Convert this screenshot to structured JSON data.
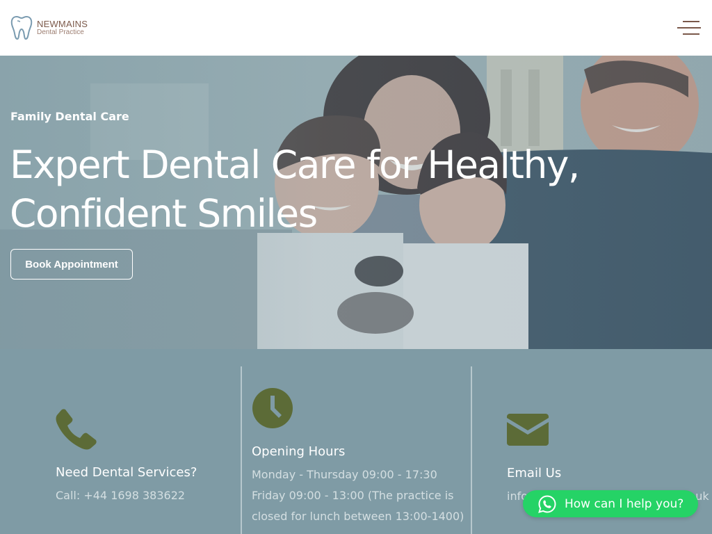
{
  "header": {
    "logo": {
      "name": "NEWMAINS",
      "subtitle": "Dental Practice",
      "icon": "tooth-icon"
    },
    "menu_icon": "hamburger-menu-icon"
  },
  "hero": {
    "eyebrow": "Family Dental Care",
    "title": "Expert Dental Care for Healthy, Confident Smiles",
    "button_label": "Book Appointment"
  },
  "info": {
    "contact": {
      "icon": "phone-icon",
      "title": "Need Dental Services?",
      "text": "Call: +44 1698 383622"
    },
    "hours": {
      "icon": "clock-icon",
      "title": "Opening Hours",
      "lines": [
        "Monday - Thursday 09:00 - 17:30",
        "Friday 09:00 - 13:00 (The practice is closed for lunch between 13:00-1400)"
      ]
    },
    "email": {
      "icon": "envelope-icon",
      "title": "Email Us",
      "text": "info@newmainsdentalpractice.co.uk"
    }
  },
  "whatsapp": {
    "icon": "whatsapp-icon",
    "label": "How can I help you?"
  },
  "colors": {
    "icon_olive": "#5c6b37",
    "brand_brown": "#7a584a",
    "whatsapp_green": "#25d366",
    "section_bg": "#7f9ba5"
  }
}
